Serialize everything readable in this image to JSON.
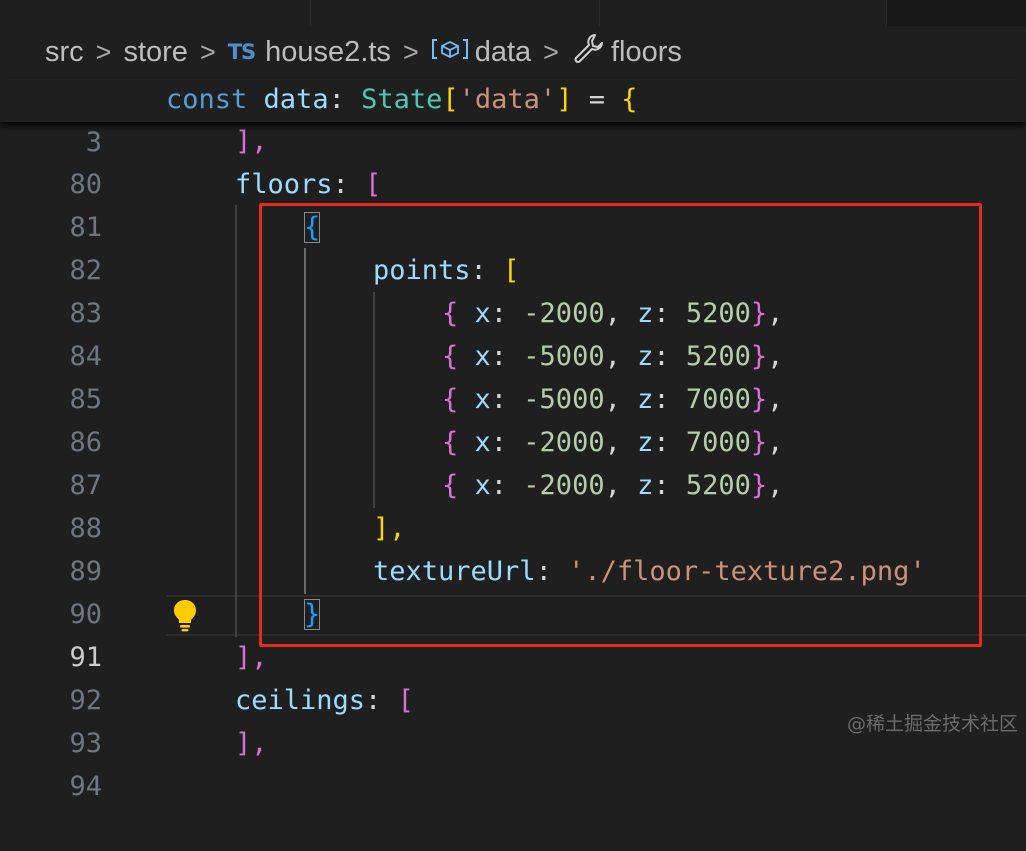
{
  "tabs": [
    {
      "label": ""
    },
    {
      "label": ""
    },
    {
      "label": ""
    }
  ],
  "breadcrumb": {
    "items": [
      "src",
      "store",
      "house2.ts",
      "data",
      "floors"
    ],
    "file_icon": "TS",
    "separator": ">"
  },
  "sticky": {
    "line_number": "3"
  },
  "lines": [
    {
      "n": "80"
    },
    {
      "n": "81"
    },
    {
      "n": "82"
    },
    {
      "n": "83"
    },
    {
      "n": "84"
    },
    {
      "n": "85"
    },
    {
      "n": "86"
    },
    {
      "n": "87"
    },
    {
      "n": "88"
    },
    {
      "n": "89"
    },
    {
      "n": "90"
    },
    {
      "n": "91"
    },
    {
      "n": "92"
    },
    {
      "n": "93"
    },
    {
      "n": "94"
    }
  ],
  "code": {
    "const": "const",
    "data": "data",
    "colon": ": ",
    "State": "State",
    "lbr": "[",
    "datakey": "'data'",
    "rbr": "]",
    "eq": " = ",
    "lbrace": "{",
    "close_arr": "],",
    "floors": "floors",
    "ceilings": "ceilings",
    "open_obj": "{",
    "points": "points",
    "x": "x",
    "z": "z",
    "points_rows": [
      {
        "x": "-2000",
        "z": "5200"
      },
      {
        "x": "-5000",
        "z": "5200"
      },
      {
        "x": "-5000",
        "z": "7000"
      },
      {
        "x": "-2000",
        "z": "7000"
      },
      {
        "x": "-2000",
        "z": "5200"
      }
    ],
    "textureUrl": "textureUrl",
    "textureValue": "'./floor-texture2.png'",
    "close_obj": "}"
  },
  "colors": {
    "highlight": "#e8291f",
    "background": "#1f1f1f"
  },
  "icons": [
    "var-icon",
    "wrench-icon",
    "lightbulb-icon"
  ],
  "watermark": "@稀土掘金技术社区"
}
